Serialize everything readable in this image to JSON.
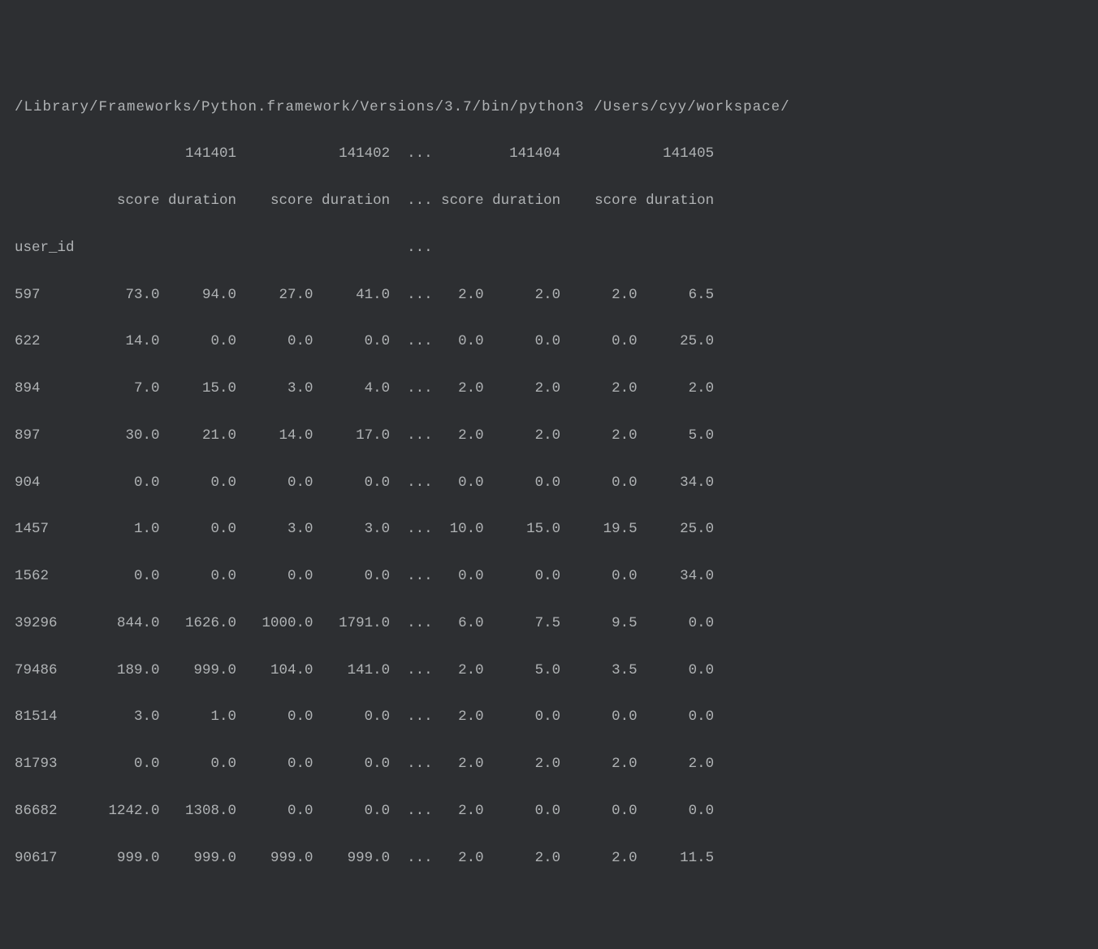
{
  "terminal": {
    "command_path": "/Library/Frameworks/Python.framework/Versions/3.7/bin/python3 /Users/cyy/workspace/",
    "chart_data": {
      "type": "table",
      "top_columns": [
        "141401",
        "141402",
        "...",
        "141404",
        "141405"
      ],
      "sub_columns": [
        "score",
        "duration",
        "score",
        "duration",
        "...",
        "score",
        "duration",
        "score",
        "duration"
      ],
      "index_name": "user_id",
      "rows": [
        {
          "id": "597",
          "v": [
            "73.0",
            "94.0",
            "27.0",
            "41.0",
            "...",
            "2.0",
            "2.0",
            "2.0",
            "6.5"
          ]
        },
        {
          "id": "622",
          "v": [
            "14.0",
            "0.0",
            "0.0",
            "0.0",
            "...",
            "0.0",
            "0.0",
            "0.0",
            "25.0"
          ]
        },
        {
          "id": "894",
          "v": [
            "7.0",
            "15.0",
            "3.0",
            "4.0",
            "...",
            "2.0",
            "2.0",
            "2.0",
            "2.0"
          ]
        },
        {
          "id": "897",
          "v": [
            "30.0",
            "21.0",
            "14.0",
            "17.0",
            "...",
            "2.0",
            "2.0",
            "2.0",
            "5.0"
          ]
        },
        {
          "id": "904",
          "v": [
            "0.0",
            "0.0",
            "0.0",
            "0.0",
            "...",
            "0.0",
            "0.0",
            "0.0",
            "34.0"
          ]
        },
        {
          "id": "1457",
          "v": [
            "1.0",
            "0.0",
            "3.0",
            "3.0",
            "...",
            "10.0",
            "15.0",
            "19.5",
            "25.0"
          ]
        },
        {
          "id": "1562",
          "v": [
            "0.0",
            "0.0",
            "0.0",
            "0.0",
            "...",
            "0.0",
            "0.0",
            "0.0",
            "34.0"
          ]
        },
        {
          "id": "39296",
          "v": [
            "844.0",
            "1626.0",
            "1000.0",
            "1791.0",
            "...",
            "6.0",
            "7.5",
            "9.5",
            "0.0"
          ]
        },
        {
          "id": "79486",
          "v": [
            "189.0",
            "999.0",
            "104.0",
            "141.0",
            "...",
            "2.0",
            "5.0",
            "3.5",
            "0.0"
          ]
        },
        {
          "id": "81514",
          "v": [
            "3.0",
            "1.0",
            "0.0",
            "0.0",
            "...",
            "2.0",
            "0.0",
            "0.0",
            "0.0"
          ]
        },
        {
          "id": "81793",
          "v": [
            "0.0",
            "0.0",
            "0.0",
            "0.0",
            "...",
            "2.0",
            "2.0",
            "2.0",
            "2.0"
          ]
        },
        {
          "id": "86682",
          "v": [
            "1242.0",
            "1308.0",
            "0.0",
            "0.0",
            "...",
            "2.0",
            "0.0",
            "0.0",
            "0.0"
          ]
        },
        {
          "id": "90617",
          "v": [
            "999.0",
            "999.0",
            "999.0",
            "999.0",
            "...",
            "2.0",
            "2.0",
            "2.0",
            "11.5"
          ]
        }
      ]
    },
    "column_widths": {
      "idx": 8,
      "col": 9
    }
  }
}
